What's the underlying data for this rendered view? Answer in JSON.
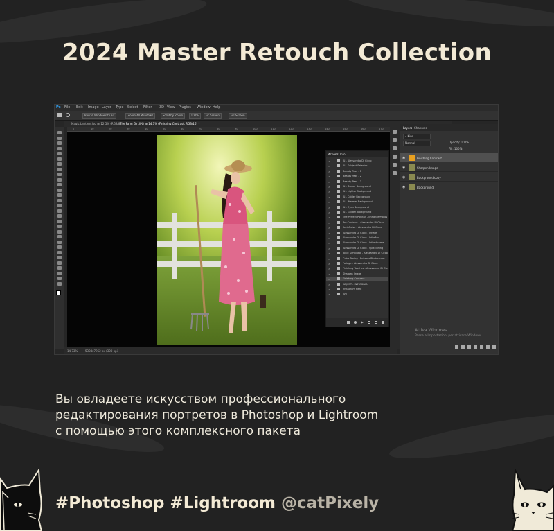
{
  "title": "2024 Master Retouch Collection",
  "description_lines": [
    "Вы овладеете искусством профессионального",
    "редактирования портретов в Photoshop и Lightroom",
    "с помощью этого комплексного пакета"
  ],
  "tags": {
    "hashtags": "#Photoshop #Lightroom",
    "handle": "@catPixely"
  },
  "photoshop": {
    "logo": "Ps",
    "menu": [
      "File",
      "Edit",
      "Image",
      "Layer",
      "Type",
      "Select",
      "Filter",
      "3D",
      "View",
      "Plugins",
      "Window",
      "Help"
    ],
    "options": [
      "Resize Windows to Fit",
      "Zoom All Windows",
      "Scrubby Zoom",
      "100%",
      "Fit Screen",
      "Fill Screen"
    ],
    "doc_tabs": [
      "Magic Lantern.jpg @ 12.5% (RGB/8)",
      "The Farm Girl.JPG @ 14.7% (Finishing Contrast, RGB/16) *"
    ],
    "ruler_marks": [
      "0",
      "10",
      "20",
      "30",
      "40",
      "50",
      "60",
      "70",
      "80",
      "90",
      "100",
      "110",
      "120",
      "130",
      "140",
      "150",
      "160",
      "170"
    ],
    "status": {
      "zoom": "14.73%",
      "doc": "5304x7952 px (300 ppi)"
    },
    "actions_panel": {
      "tabs": [
        "Actions",
        "Info"
      ],
      "rows": [
        {
          "label": "AI - Alessandro Di Cicco",
          "sel": false
        },
        {
          "label": "AI - Subject Selector",
          "sel": false
        },
        {
          "label": "Beauty Pass - 1",
          "sel": false
        },
        {
          "label": "Beauty Pass - 2",
          "sel": false
        },
        {
          "label": "Beauty Pass - 3",
          "sel": false
        },
        {
          "label": "AI - Darker Background",
          "sel": false
        },
        {
          "label": "AI - Lighter Background",
          "sel": false
        },
        {
          "label": "AI - Colder Background",
          "sel": false
        },
        {
          "label": "AI - Warmer Background",
          "sel": false
        },
        {
          "label": "AI - Cyan Background",
          "sel": false
        },
        {
          "label": "AI - Golden Background",
          "sel": false
        },
        {
          "label": "The Perfect Portrait - EnhancePhotos",
          "sel": false
        },
        {
          "label": "Pro Contrast - Alessandro Di Cicco",
          "sel": false
        },
        {
          "label": "ActioNoise - Alessandro Di Cicco",
          "sel": false
        },
        {
          "label": "Alessandro Di Cicco - Inflate",
          "sel": false
        },
        {
          "label": "Alessandro Di Cicco - InfraRed",
          "sel": false
        },
        {
          "label": "Alessandro Di Cicco - Infrachrome",
          "sel": false
        },
        {
          "label": "Alessandro Di Cicco - Split Toning",
          "sel": false
        },
        {
          "label": "Tonic Simulator - Alessandro Di Cicco",
          "sel": false
        },
        {
          "label": "Color Toning - EnhancePhotos.com",
          "sel": false
        },
        {
          "label": "Foliage - Alessandro Di Cicco",
          "sel": false
        },
        {
          "label": "Finishing Touches - Alessandro Di Cicco",
          "sel": false
        },
        {
          "label": "Sharpen Image",
          "sel": false
        },
        {
          "label": "Finishing Contrast",
          "sel": true
        },
        {
          "label": "ADJUST - INSTAGRAM",
          "sel": false
        },
        {
          "label": "Instagram Hero",
          "sel": false
        },
        {
          "label": "ART",
          "sel": false
        }
      ]
    },
    "layers_panel": {
      "tabs": [
        "Layers",
        "Channels"
      ],
      "kind": "Kind",
      "mode": "Normal",
      "opacity": "Opacity: 100%",
      "fill": "Fill: 100%",
      "layers": [
        {
          "name": "Finishing Contrast",
          "sel": true
        },
        {
          "name": "Sharpen Image",
          "sel": false
        },
        {
          "name": "Background copy",
          "sel": false
        },
        {
          "name": "Background",
          "sel": false
        }
      ]
    },
    "watermark": {
      "line1": "Attiva Windows",
      "line2": "Passa a Impostazioni per attivare Windows."
    }
  },
  "colors": {
    "background": "#222222",
    "title": "#f3ead5",
    "handle": "#b9b3a6"
  }
}
